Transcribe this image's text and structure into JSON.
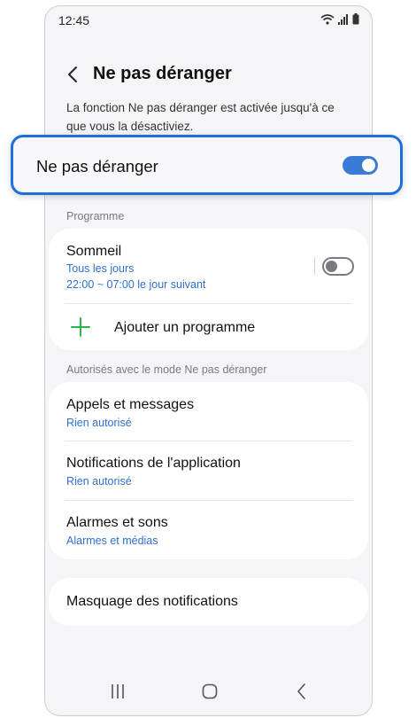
{
  "status_bar": {
    "time": "12:45"
  },
  "header": {
    "title": "Ne pas déranger"
  },
  "description": "La fonction Ne pas déranger est activée jusqu'à ce que vous la désactiviez.",
  "master_toggle": {
    "label": "Ne pas déranger",
    "enabled": true
  },
  "schedule_section": {
    "label": "Programme",
    "sleep": {
      "title": "Sommeil",
      "days": "Tous les jours",
      "time": "22:00 ~ 07:00 le jour suivant",
      "enabled": false
    },
    "add_label": "Ajouter un programme"
  },
  "allowed_section": {
    "label": "Autorisés avec le mode Ne pas déranger",
    "items": [
      {
        "title": "Appels et messages",
        "sub": "Rien autorisé"
      },
      {
        "title": "Notifications de l'application",
        "sub": "Rien autorisé"
      },
      {
        "title": "Alarmes et sons",
        "sub": "Alarmes et médias"
      }
    ]
  },
  "hide_notifications": {
    "label": "Masquage des notifications"
  },
  "colors": {
    "accent": "#3a7bd5",
    "link": "#2f6fcf",
    "highlight_border": "#1d6fe0",
    "add_icon": "#2bb24c"
  }
}
